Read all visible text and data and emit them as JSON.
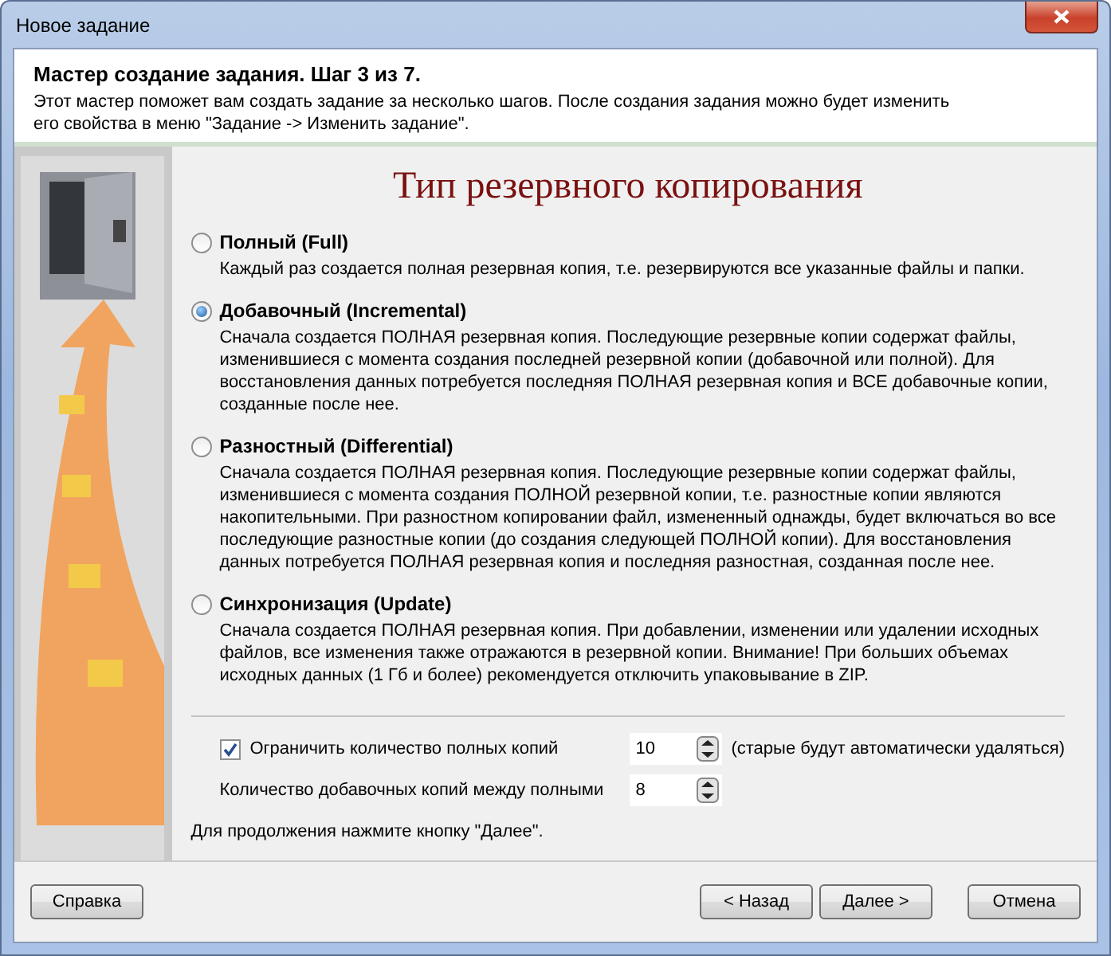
{
  "window": {
    "title": "Новое задание"
  },
  "header": {
    "title": "Мастер создание задания.  Шаг 3 из 7.",
    "description": "Этот мастер поможет вам создать задание за несколько шагов. После создания задания можно будет изменить его свойства в меню \"Задание -> Изменить задание\"."
  },
  "page_title": "Тип резервного копирования",
  "options": [
    {
      "label": "Полный (Full)",
      "selected": false,
      "description": "Каждый раз создается полная резервная копия, т.е. резервируются все указанные файлы и папки."
    },
    {
      "label": "Добавочный (Incremental)",
      "selected": true,
      "description": "Сначала создается ПОЛНАЯ резервная копия. Последующие резервные копии содержат файлы, изменившиеся с момента создания последней резервной копии (добавочной или полной). Для восстановления данных потребуется последняя ПОЛНАЯ резервная копия и ВСЕ добавочные копии, созданные после нее."
    },
    {
      "label": "Разностный (Differential)",
      "selected": false,
      "description": "Сначала создается ПОЛНАЯ резервная копия. Последующие резервные копии содержат файлы, изменившиеся с момента создания ПОЛНОЙ резервной копии, т.е. разностные копии являются накопительными. При разностном копировании файл, измененный однажды, будет включаться во все последующие разностные копии (до создания следующей ПОЛНОЙ копии). Для восстановления данных потребуется ПОЛНАЯ резервная копия и последняя разностная, созданная после нее."
    },
    {
      "label": "Синхронизация (Update)",
      "selected": false,
      "description": "Сначала создается ПОЛНАЯ резервная копия. При добавлении, изменении или удалении исходных файлов, все изменения также отражаются в резервной копии. Внимание! При больших объемах исходных данных (1 Гб и более) рекомендуется отключить упаковывание в ZIP."
    }
  ],
  "settings": [
    {
      "kind": "checkbox",
      "label": "Ограничить количество полных копий",
      "checked": true,
      "value": "10",
      "note": "(старые будут автоматически удаляться)"
    },
    {
      "kind": "plain",
      "label": "Количество добавочных копий между полными",
      "value": "8"
    }
  ],
  "hint": "Для продолжения нажмите кнопку \"Далее\".",
  "buttons": {
    "help": "Справка",
    "back": "< Назад",
    "next": "Далее >",
    "cancel": "Отмена"
  }
}
